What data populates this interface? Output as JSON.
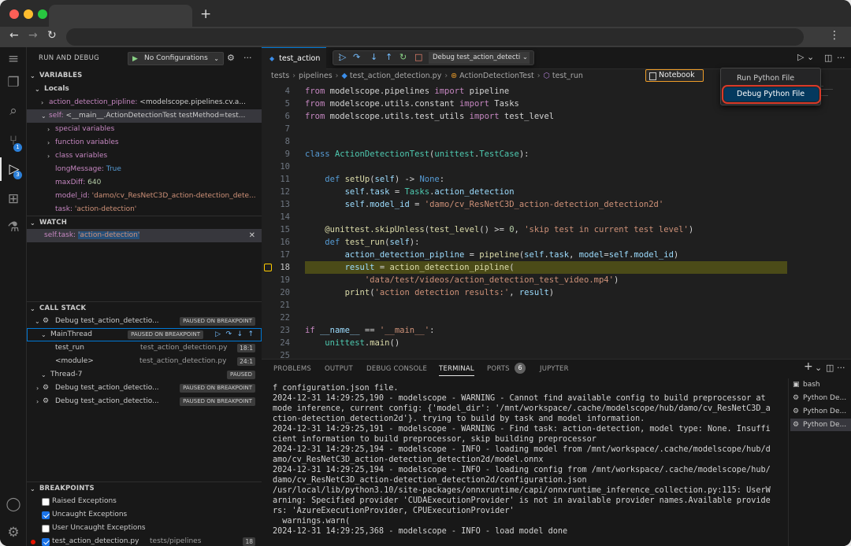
{
  "sidebar": {
    "title": "RUN AND DEBUG",
    "config_label": "No Configurations",
    "sections": {
      "variables": "VARIABLES",
      "watch": "WATCH",
      "call_stack": "CALL STACK",
      "breakpoints": "BREAKPOINTS"
    },
    "locals_label": "Locals",
    "variables": [
      {
        "name": "action_detection_pipline:",
        "value": "<modelscope.pipelines.cv.a..."
      },
      {
        "name": "self:",
        "value": "<__main__.ActionDetectionTest testMethod=test..."
      },
      {
        "name": "special variables",
        "value": ""
      },
      {
        "name": "function variables",
        "value": ""
      },
      {
        "name": "class variables",
        "value": ""
      },
      {
        "name": "longMessage:",
        "value": "True"
      },
      {
        "name": "maxDiff:",
        "value": "640"
      },
      {
        "name": "model_id:",
        "value": "'damo/cv_ResNetC3D_action-detection_dete..."
      },
      {
        "name": "task:",
        "value": "'action-detection'"
      }
    ],
    "watch": {
      "name": "self.task:",
      "value": "'action-detection'"
    },
    "call_stack": [
      {
        "label": "Debug test_action_detectio...",
        "tag": "PAUSED ON BREAKPOINT"
      },
      {
        "label": "MainThread",
        "tag": "PAUSED ON BREAKPOINT"
      },
      {
        "label": "test_run",
        "file": "test_action_detection.py",
        "line": "18:1"
      },
      {
        "label": "<module>",
        "file": "test_action_detection.py",
        "line": "24:1"
      },
      {
        "label": "Thread-7",
        "tag": "PAUSED"
      },
      {
        "label": "Debug test_action_detectio...",
        "tag": "PAUSED ON BREAKPOINT"
      },
      {
        "label": "Debug test_action_detectio...",
        "tag": "PAUSED ON BREAKPOINT"
      }
    ],
    "breakpoints": [
      {
        "label": "Raised Exceptions",
        "checked": false
      },
      {
        "label": "Uncaught Exceptions",
        "checked": true
      },
      {
        "label": "User Uncaught Exceptions",
        "checked": false
      },
      {
        "label": "test_action_detection.py",
        "path": "tests/pipelines",
        "line": "18",
        "checked": true
      }
    ]
  },
  "activity_badges": {
    "source_control": "1",
    "debug": "3"
  },
  "editor": {
    "tab_label": "test_action_detection.py",
    "tab_short": "test_action",
    "debug_config": "Debug test_action_detecti",
    "breadcrumb": [
      "tests",
      "pipelines",
      "test_action_detection.py",
      "ActionDetectionTest",
      "test_run"
    ],
    "notebook_label": "Notebook",
    "run_menu": [
      "Run Python File",
      "Debug Python File"
    ],
    "code_lines": [
      {
        "n": "4",
        "t": [
          [
            "kw",
            "from"
          ],
          [
            "tx",
            " modelscope.pipelines "
          ],
          [
            "kw",
            "import"
          ],
          [
            "tx",
            " pipeline"
          ]
        ]
      },
      {
        "n": "5",
        "t": [
          [
            "kw",
            "from"
          ],
          [
            "tx",
            " modelscope.utils.constant "
          ],
          [
            "kw",
            "import"
          ],
          [
            "tx",
            " Tasks"
          ]
        ]
      },
      {
        "n": "6",
        "t": [
          [
            "kw",
            "from"
          ],
          [
            "tx",
            " modelscope.utils.test_utils "
          ],
          [
            "kw",
            "import"
          ],
          [
            "tx",
            " test_level"
          ]
        ]
      },
      {
        "n": "7",
        "t": []
      },
      {
        "n": "8",
        "t": []
      },
      {
        "n": "9",
        "t": [
          [
            "k2",
            "class"
          ],
          [
            "tx",
            " "
          ],
          [
            "cls2",
            "ActionDetectionTest"
          ],
          [
            "tx",
            "("
          ],
          [
            "cls2",
            "unittest"
          ],
          [
            "tx",
            "."
          ],
          [
            "cls2",
            "TestCase"
          ],
          [
            "tx",
            "):"
          ]
        ]
      },
      {
        "n": "10",
        "t": []
      },
      {
        "n": "11",
        "t": [
          [
            "tx",
            "    "
          ],
          [
            "k2",
            "def"
          ],
          [
            "tx",
            " "
          ],
          [
            "fn",
            "setUp"
          ],
          [
            "tx",
            "("
          ],
          [
            "va",
            "self"
          ],
          [
            "tx",
            ") -> "
          ],
          [
            "k2",
            "None"
          ],
          [
            "tx",
            ":"
          ]
        ]
      },
      {
        "n": "12",
        "t": [
          [
            "tx",
            "        "
          ],
          [
            "va",
            "self"
          ],
          [
            "tx",
            "."
          ],
          [
            "va",
            "task"
          ],
          [
            "tx",
            " = "
          ],
          [
            "cls2",
            "Tasks"
          ],
          [
            "tx",
            "."
          ],
          [
            "va",
            "action_detection"
          ]
        ]
      },
      {
        "n": "13",
        "t": [
          [
            "tx",
            "        "
          ],
          [
            "va",
            "self"
          ],
          [
            "tx",
            "."
          ],
          [
            "va",
            "model_id"
          ],
          [
            "tx",
            " = "
          ],
          [
            "str",
            "'damo/cv_ResNetC3D_action-detection_detection2d'"
          ]
        ]
      },
      {
        "n": "14",
        "t": []
      },
      {
        "n": "15",
        "t": [
          [
            "tx",
            "    "
          ],
          [
            "fn",
            "@unittest.skipUnless"
          ],
          [
            "tx",
            "("
          ],
          [
            "fn",
            "test_level"
          ],
          [
            "tx",
            "() >= "
          ],
          [
            "nm",
            "0"
          ],
          [
            "tx",
            ", "
          ],
          [
            "str",
            "'skip test in current test level'"
          ],
          [
            "tx",
            ")"
          ]
        ]
      },
      {
        "n": "16",
        "t": [
          [
            "tx",
            "    "
          ],
          [
            "k2",
            "def"
          ],
          [
            "tx",
            " "
          ],
          [
            "fn",
            "test_run"
          ],
          [
            "tx",
            "("
          ],
          [
            "va",
            "self"
          ],
          [
            "tx",
            "):"
          ]
        ]
      },
      {
        "n": "17",
        "t": [
          [
            "tx",
            "        "
          ],
          [
            "va",
            "action_detection_pipline"
          ],
          [
            "tx",
            " = "
          ],
          [
            "fn",
            "pipeline"
          ],
          [
            "tx",
            "("
          ],
          [
            "va",
            "self"
          ],
          [
            "tx",
            "."
          ],
          [
            "va",
            "task"
          ],
          [
            "tx",
            ", "
          ],
          [
            "va",
            "model"
          ],
          [
            "tx",
            "="
          ],
          [
            "va",
            "self"
          ],
          [
            "tx",
            "."
          ],
          [
            "va",
            "model_id"
          ],
          [
            "tx",
            ")"
          ]
        ]
      },
      {
        "n": "18",
        "t": [
          [
            "tx",
            "        "
          ],
          [
            "va",
            "result"
          ],
          [
            "tx",
            " = "
          ],
          [
            "fn",
            "action_detection_pipline"
          ],
          [
            "tx",
            "("
          ]
        ],
        "hl": true
      },
      {
        "n": "19",
        "t": [
          [
            "tx",
            "            "
          ],
          [
            "str",
            "'data/test/videos/action_detection_test_video.mp4'"
          ],
          [
            "tx",
            ")"
          ]
        ]
      },
      {
        "n": "20",
        "t": [
          [
            "tx",
            "        "
          ],
          [
            "fn",
            "print"
          ],
          [
            "tx",
            "("
          ],
          [
            "str",
            "'action detection results:'"
          ],
          [
            "tx",
            ", "
          ],
          [
            "va",
            "result"
          ],
          [
            "tx",
            ")"
          ]
        ]
      },
      {
        "n": "21",
        "t": []
      },
      {
        "n": "22",
        "t": []
      },
      {
        "n": "23",
        "t": [
          [
            "kw",
            "if"
          ],
          [
            "tx",
            " "
          ],
          [
            "va",
            "__name__"
          ],
          [
            "tx",
            " == "
          ],
          [
            "str",
            "'__main__'"
          ],
          [
            "tx",
            ":"
          ]
        ]
      },
      {
        "n": "24",
        "t": [
          [
            "tx",
            "    "
          ],
          [
            "cls2",
            "unittest"
          ],
          [
            "tx",
            "."
          ],
          [
            "fn",
            "main"
          ],
          [
            "tx",
            "()"
          ]
        ]
      },
      {
        "n": "25",
        "t": []
      }
    ]
  },
  "panel": {
    "tabs": [
      "PROBLEMS",
      "OUTPUT",
      "DEBUG CONSOLE",
      "TERMINAL",
      "PORTS",
      "JUPYTER"
    ],
    "ports_count": "6",
    "terminal_lines": [
      "f configuration.json file.",
      "2024-12-31 14:29:25,190 - modelscope - WARNING - Cannot find available config to build preprocessor at",
      "mode inference, current config: {'model_dir': '/mnt/workspace/.cache/modelscope/hub/damo/cv_ResNetC3D_a",
      "ction-detection_detection2d'}. trying to build by task and model information.",
      "2024-12-31 14:29:25,191 - modelscope - WARNING - Find task: action-detection, model type: None. Insuffi",
      "cient information to build preprocessor, skip building preprocessor",
      "2024-12-31 14:29:25,194 - modelscope - INFO - loading model from /mnt/workspace/.cache/modelscope/hub/d",
      "amo/cv_ResNetC3D_action-detection_detection2d/model.onnx",
      "2024-12-31 14:29:25,194 - modelscope - INFO - loading config from /mnt/workspace/.cache/modelscope/hub/",
      "damo/cv_ResNetC3D_action-detection_detection2d/configuration.json",
      "/usr/local/lib/python3.10/site-packages/onnxruntime/capi/onnxruntime_inference_collection.py:115: UserW",
      "arning: Specified provider 'CUDAExecutionProvider' is not in available provider names.Available provide",
      "rs: 'AzureExecutionProvider, CPUExecutionProvider'",
      "  warnings.warn(",
      "2024-12-31 14:29:25,368 - modelscope - INFO - load model done"
    ],
    "terminals": [
      "bash",
      "Python De...",
      "Python De...",
      "Python De..."
    ]
  },
  "colors": {
    "accent": "#0078d4",
    "breakpoint_line": "#4b4b18",
    "menu_outline": "#d83a2a"
  }
}
